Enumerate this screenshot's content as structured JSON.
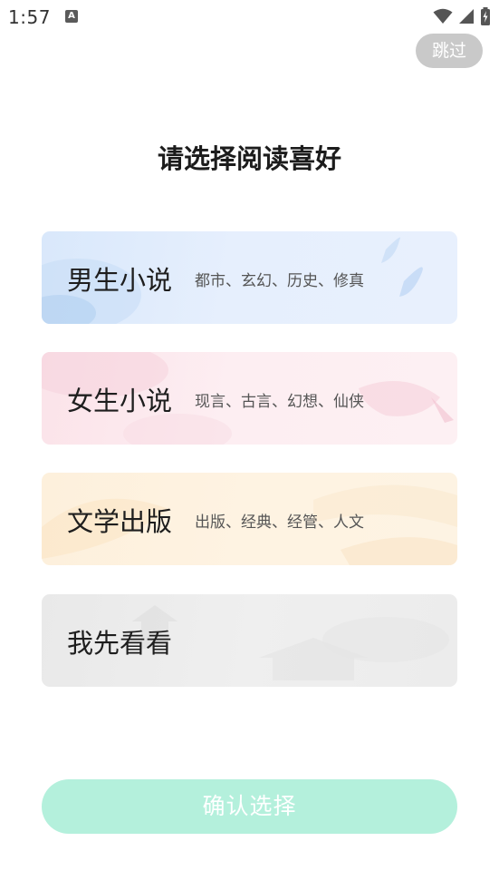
{
  "status_bar": {
    "time": "1:57",
    "app_icon_letter": "A",
    "icons": [
      "wifi-icon",
      "cell-signal-icon",
      "battery-charging-icon"
    ]
  },
  "skip_label": "跳过",
  "title": "请选择阅读喜好",
  "cards": [
    {
      "name": "男生小说",
      "tags": "都市、玄幻、历史、修真",
      "tint": "#e6effd"
    },
    {
      "name": "女生小说",
      "tags": "现言、古言、幻想、仙侠",
      "tint": "#fdeef2"
    },
    {
      "name": "文学出版",
      "tags": "出版、经典、经管、人文",
      "tint": "#fef3e2"
    },
    {
      "name": "我先看看",
      "tags": "",
      "tint": "#efefef"
    }
  ],
  "confirm_label": "确认选择",
  "colors": {
    "skip_bg": "#c9c9c9",
    "confirm_bg": "#b4f0dc",
    "title": "#1c1c1c"
  }
}
